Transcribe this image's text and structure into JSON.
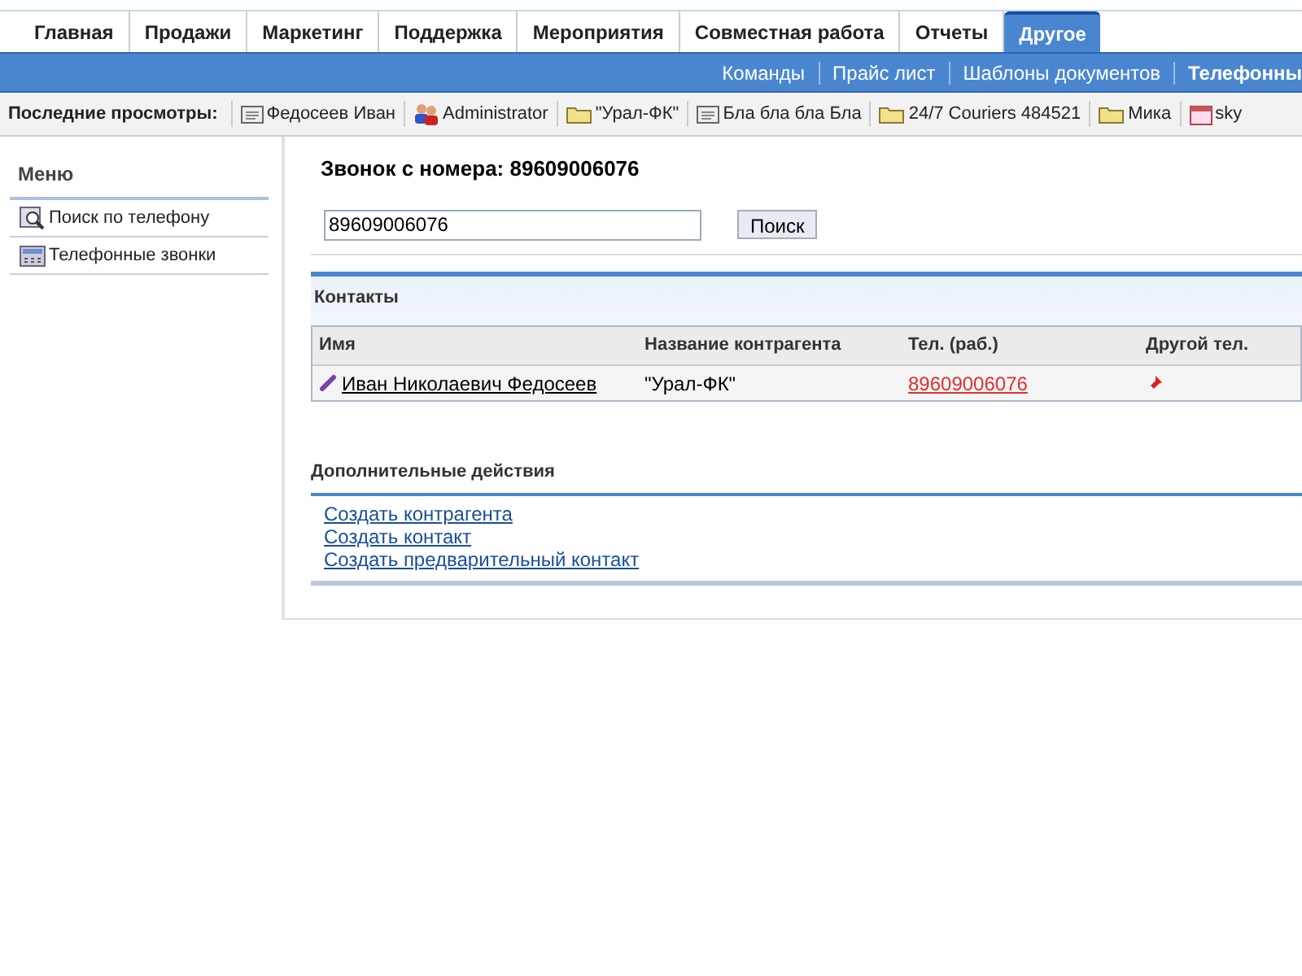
{
  "tabs": [
    {
      "label": "Главная",
      "selected": false
    },
    {
      "label": "Продажи",
      "selected": false
    },
    {
      "label": "Маркетинг",
      "selected": false
    },
    {
      "label": "Поддержка",
      "selected": false
    },
    {
      "label": "Мероприятия",
      "selected": false
    },
    {
      "label": "Совместная работа",
      "selected": false
    },
    {
      "label": "Отчеты",
      "selected": false
    },
    {
      "label": "Другое",
      "selected": true
    }
  ],
  "subnav": [
    {
      "label": "Команды",
      "selected": false
    },
    {
      "label": "Прайс лист",
      "selected": false
    },
    {
      "label": "Шаблоны документов",
      "selected": false
    },
    {
      "label": "Телефонны",
      "selected": true
    }
  ],
  "recent": {
    "label": "Последние просмотры:",
    "items": [
      {
        "label": "Федосеев  Иван",
        "kind": "card"
      },
      {
        "label": "Administrator",
        "kind": "users"
      },
      {
        "label": "\"Урал-ФК\"",
        "kind": "folder"
      },
      {
        "label": "Бла бла бла Бла",
        "kind": "card"
      },
      {
        "label": "24/7 Couriers 484521",
        "kind": "folder"
      },
      {
        "label": "Мика",
        "kind": "folder"
      },
      {
        "label": "sky",
        "kind": "calendar"
      }
    ]
  },
  "sidebar": {
    "title": "Меню",
    "items": [
      {
        "label": "Поиск по телефону",
        "kind": "search"
      },
      {
        "label": "Телефонные звонки",
        "kind": "phone"
      }
    ]
  },
  "main": {
    "title": "Звонок с номера: 89609006076",
    "search": {
      "value": "89609006076",
      "button": "Поиск"
    },
    "contacts": {
      "title": "Контакты",
      "columns": [
        "Имя",
        "Название контрагента",
        "Тел. (раб.)",
        "Другой тел."
      ],
      "rows": [
        {
          "name": "Иван Николаевич Федосеев",
          "company": "\"Урал-ФК\"",
          "work_phone": "89609006076"
        }
      ]
    },
    "actions": {
      "title": "Дополнительные действия",
      "links": [
        "Создать контрагента",
        "Создать контакт",
        "Создать предварительный контакт"
      ]
    }
  }
}
